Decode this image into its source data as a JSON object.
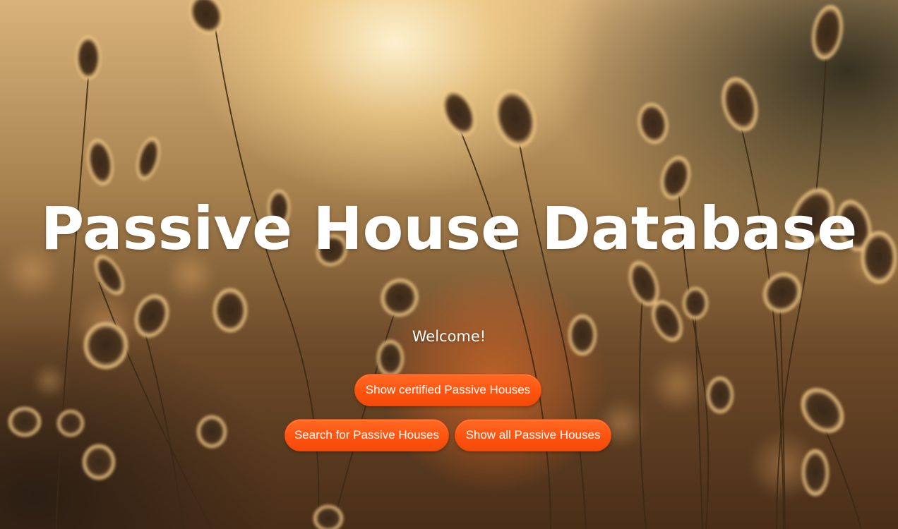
{
  "hero": {
    "title": "Passive House Database",
    "welcome": "Welcome!"
  },
  "buttons": {
    "certified_label": "Show certified Passive Houses",
    "search_label": "Search for Passive Houses",
    "all_label": "Show all Passive Houses"
  },
  "colors": {
    "button_orange": "#ff5410",
    "text_white": "#ffffff"
  }
}
